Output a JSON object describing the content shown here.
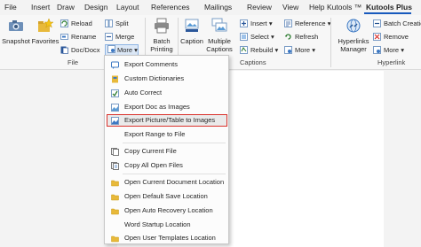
{
  "menubar": {
    "tabs": [
      "File",
      "Insert",
      "Draw",
      "Design",
      "Layout",
      "References",
      "Mailings",
      "Review",
      "View",
      "Help",
      "Kutools ™",
      "Kutools Plus"
    ],
    "active_tab": "Kutools Plus"
  },
  "ribbon": {
    "snapshot": "Snapshot",
    "favorites": "Favorites",
    "reload": "Reload",
    "rename": "Rename",
    "doc_docx": "Doc/Docx",
    "split": "Split",
    "merge": "Merge",
    "more": "More",
    "batch_printing_1": "Batch",
    "batch_printing_2": "Printing",
    "caption": "Caption",
    "multiple_captions_1": "Multiple",
    "multiple_captions_2": "Captions",
    "insert": "Insert",
    "select": "Select",
    "rebuild": "Rebuild",
    "reference": "Reference",
    "refresh": "Refresh",
    "more2": "More",
    "hyperlinks_manager_1": "Hyperlinks",
    "hyperlinks_manager_2": "Manager",
    "batch_creation": "Batch Creation",
    "remove": "Remove",
    "more3": "More",
    "group_file": "File",
    "group_captions": "Captions",
    "group_hyperlink": "Hyperlink"
  },
  "dropdown": {
    "items": [
      {
        "label": "Export Comments",
        "icon": "export-comments-icon"
      },
      {
        "label": "Custom Dictionaries",
        "icon": "dictionary-icon"
      },
      {
        "label": "Auto Correct",
        "icon": "auto-correct-icon"
      },
      {
        "label": "Export Doc as Images",
        "icon": "image-export-icon"
      },
      {
        "label": "Export Picture/Table to Images",
        "icon": "picture-export-icon"
      },
      {
        "label": "Export Range to File",
        "icon": ""
      },
      {
        "label": "Copy Current File",
        "icon": "copy-file-icon"
      },
      {
        "label": "Copy All Open Files",
        "icon": "copy-files-icon"
      },
      {
        "label": "Open Current Document Location",
        "icon": "folder-icon"
      },
      {
        "label": "Open Default Save Location",
        "icon": "folder-icon"
      },
      {
        "label": "Open Auto Recovery Location",
        "icon": "folder-icon"
      },
      {
        "label": "Word Startup Location",
        "icon": ""
      },
      {
        "label": "Open User Templates Location",
        "icon": "folder-icon"
      }
    ],
    "highlighted_index": 4
  },
  "colors": {
    "accent": "#185abd",
    "highlight_border": "#d9312b",
    "folder": "#e8b93a"
  }
}
